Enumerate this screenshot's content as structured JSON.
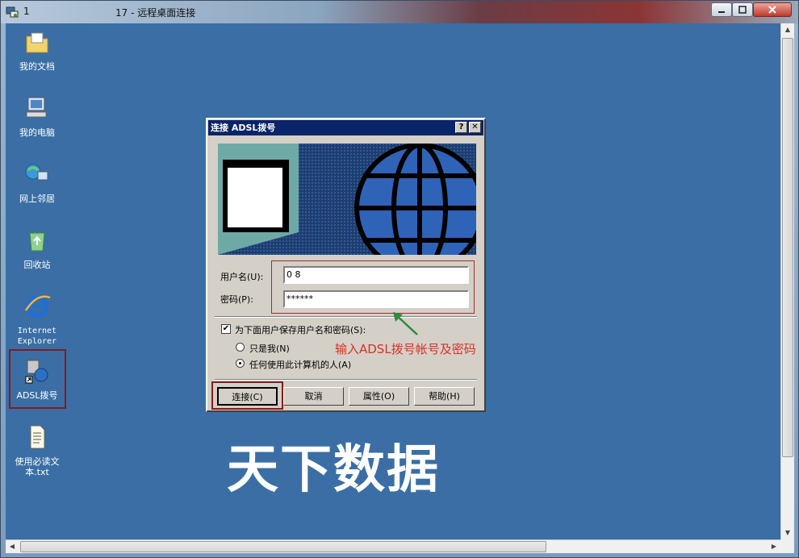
{
  "window": {
    "number": "1",
    "title": "17 - 远程桌面连接"
  },
  "desktop": {
    "icons": [
      {
        "label": "我的文档",
        "icon": "my-documents-icon"
      },
      {
        "label": "我的电脑",
        "icon": "my-computer-icon"
      },
      {
        "label": "网上邻居",
        "icon": "network-places-icon"
      },
      {
        "label": "回收站",
        "icon": "recycle-bin-icon"
      },
      {
        "label": "Internet Explorer",
        "icon": "internet-explorer-icon"
      },
      {
        "label": "ADSL拨号",
        "icon": "adsl-dialup-icon"
      },
      {
        "label": "使用必读文本.txt",
        "icon": "text-file-icon"
      }
    ]
  },
  "dialog": {
    "title": "连接 ADSL拨号",
    "username_label": "用户名(U):",
    "username_value": "0                 8",
    "password_label": "密码(P):",
    "password_value": "******",
    "save_label": "为下面用户保存用户名和密码(S):",
    "radio_me": "只是我(N)",
    "radio_anyone": "任何使用此计算机的人(A)",
    "buttons": {
      "connect": "连接(C)",
      "cancel": "取消",
      "properties": "属性(O)",
      "help": "帮助(H)"
    }
  },
  "annotation": "输入ADSL拨号帐号及密码",
  "watermark": "天下数据",
  "colors": {
    "desktop": "#3a6ea5",
    "dialog_title": "#0a246a",
    "highlight": "#8b1a1a",
    "annotation": "#d93025"
  }
}
